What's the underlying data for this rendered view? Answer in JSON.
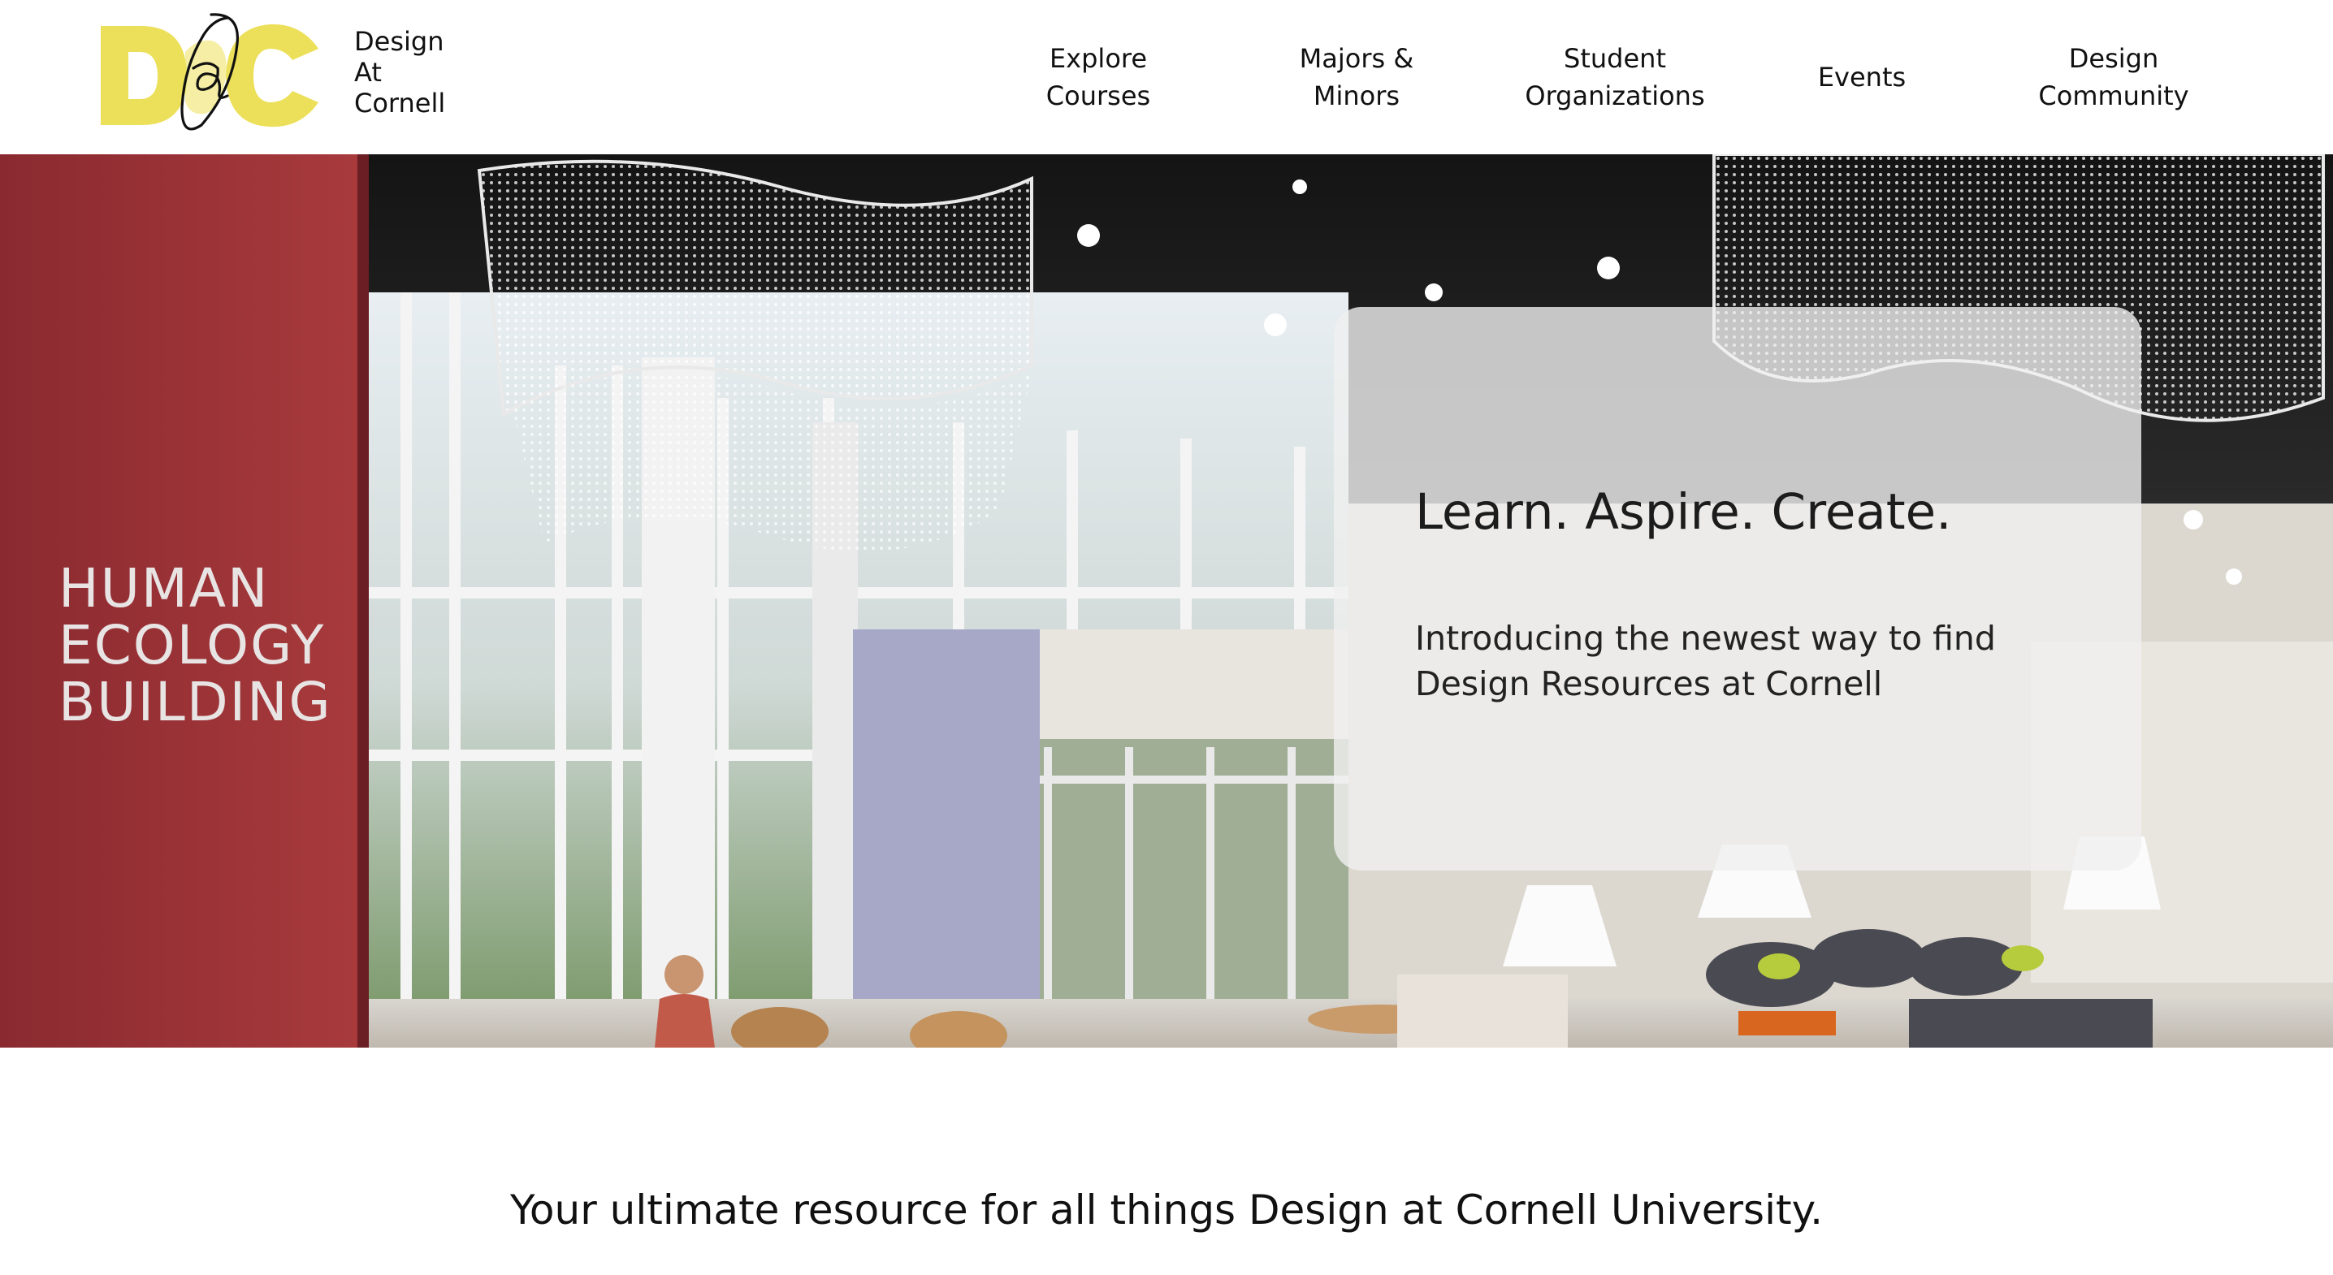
{
  "brand": {
    "logo_letters": "DC",
    "name_lines": [
      "Design",
      "At",
      "Cornell"
    ],
    "logo_color": "#ece05a"
  },
  "nav": {
    "items": [
      {
        "label": "Explore\nCourses"
      },
      {
        "label": "Majors &\nMinors"
      },
      {
        "label": "Student\nOrganizations"
      },
      {
        "label": "Events"
      },
      {
        "label": "Design\nCommunity"
      }
    ]
  },
  "hero": {
    "sign_lines": [
      "HUMAN",
      "ECOLOGY",
      "BUILDING"
    ],
    "title": "Learn. Aspire. Create.",
    "subtitle": "Introducing the newest way to find Design Resources at Cornell"
  },
  "tagline": "Your ultimate resource for all things Design at Cornell University."
}
